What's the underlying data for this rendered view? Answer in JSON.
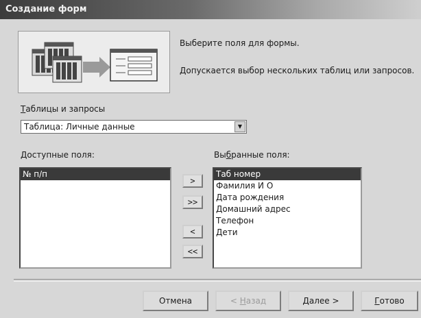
{
  "window": {
    "title": "Создание форм"
  },
  "info": {
    "line1": "Выберите поля для формы.",
    "line2": "Допускается выбор нескольких таблиц или запросов."
  },
  "tables_label": {
    "underlined": "Т",
    "rest": "аблицы и запросы"
  },
  "table_select": {
    "value": "Таблица: Личные данные",
    "arrow": "▼"
  },
  "available": {
    "label_underlined": "Д",
    "label_rest": "оступные поля:",
    "items": [
      "№ п/п"
    ]
  },
  "selected": {
    "label_a": "Вы",
    "label_underlined": "б",
    "label_b": "ранные поля:",
    "items": [
      "Таб номер",
      "Фамилия И О",
      "Дата рождения",
      "Домашний адрес",
      "Телефон",
      "Дети"
    ]
  },
  "move_buttons": {
    "add_one": ">",
    "add_all": ">>",
    "remove_one": "<",
    "remove_all": "<<"
  },
  "buttons": {
    "cancel": "Отмена",
    "back_prefix": "< ",
    "back_underlined": "Н",
    "back_rest": "азад",
    "next_underlined": "Д",
    "next_rest": "алее >",
    "finish_underlined": "Г",
    "finish_rest": "отово"
  }
}
